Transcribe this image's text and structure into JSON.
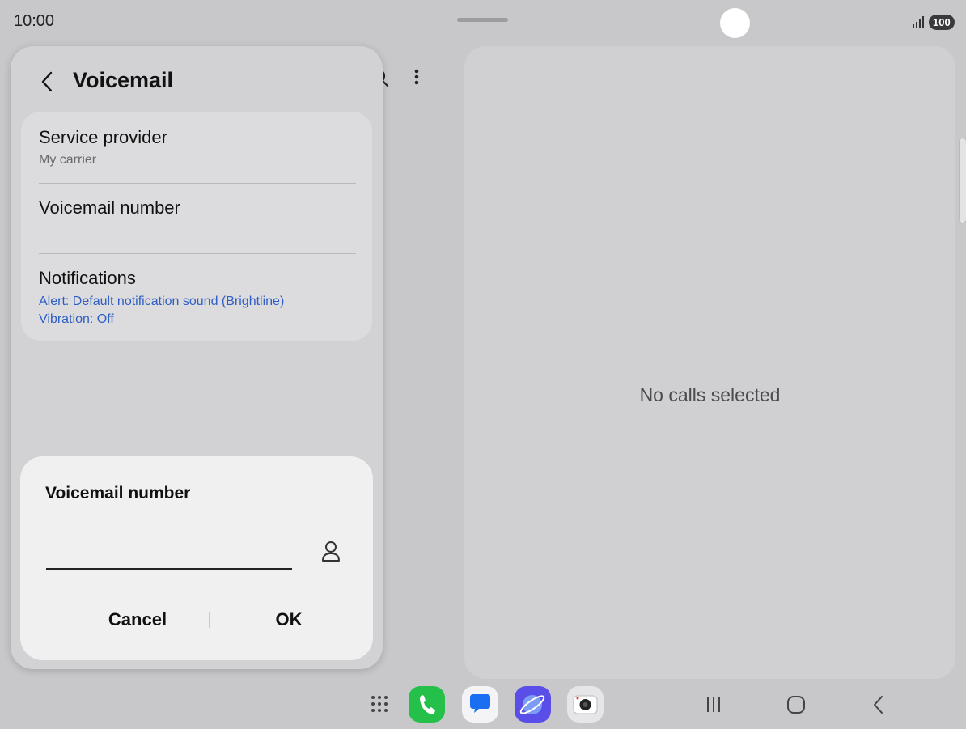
{
  "status_bar": {
    "time": "10:00",
    "battery": "100",
    "signal_icon": "signal-bars-icon"
  },
  "header": {
    "title": "Voicemail",
    "back_icon": "back-arrow-icon",
    "search_icon": "search-icon",
    "more_icon": "more-vert-icon"
  },
  "settings": {
    "items": [
      {
        "title": "Service provider",
        "subtitle": "My carrier"
      },
      {
        "title": "Voicemail number",
        "subtitle": ""
      },
      {
        "title": "Notifications",
        "subtitle_lines": [
          "Alert: Default notification sound (Brightline)",
          "Vibration: Off"
        ]
      }
    ]
  },
  "dialog": {
    "title": "Voicemail number",
    "input_value": "",
    "contact_icon": "person-icon",
    "cancel_label": "Cancel",
    "ok_label": "OK"
  },
  "right_pane": {
    "empty_text": "No calls selected"
  },
  "taskbar": {
    "apps": [
      {
        "name": "phone-app-icon",
        "color": "#25c04a"
      },
      {
        "name": "messages-app-icon",
        "color": "#1a6ef2"
      },
      {
        "name": "internet-app-icon",
        "color": "#5a4ee8"
      },
      {
        "name": "camera-app-icon",
        "color": "#e6e6e8"
      }
    ],
    "nav": [
      "recents-icon",
      "home-icon",
      "back-nav-icon"
    ]
  },
  "colors": {
    "accent_blue": "#2f5fc4",
    "background": "#c8c8ca",
    "dialog_bg": "#f0f0f0"
  }
}
